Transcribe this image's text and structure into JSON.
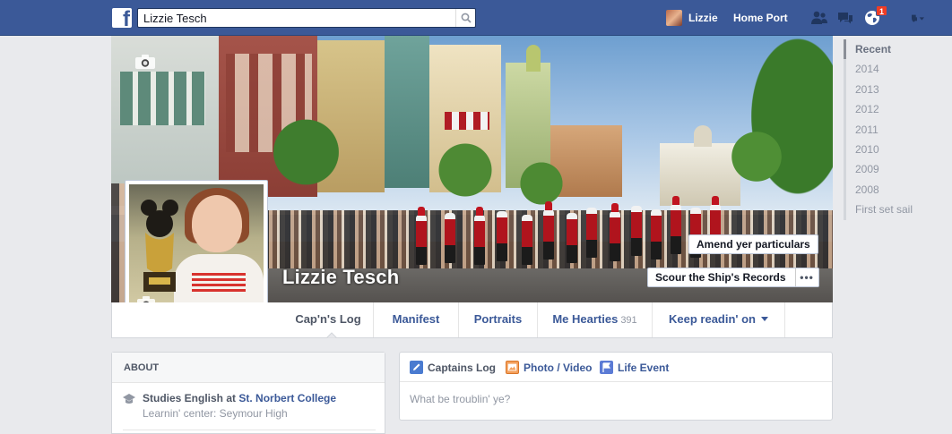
{
  "topbar": {
    "search_value": "Lizzie Tesch",
    "user_name": "Lizzie",
    "home_label": "Home Port",
    "notification_count": "1",
    "brand_color": "#3b5998"
  },
  "cover": {
    "profile_name": "Lizzie Tesch",
    "update_info_label": "Amend yer particulars",
    "activity_log_label": "Scour the Ship's Records",
    "more_label": "•••"
  },
  "tabs": [
    {
      "label": "Cap'n's Log",
      "count": ""
    },
    {
      "label": "Manifest",
      "count": ""
    },
    {
      "label": "Portraits",
      "count": ""
    },
    {
      "label": "Me Hearties",
      "count": "391"
    },
    {
      "label": "Keep readin' on",
      "count": ""
    }
  ],
  "timeline_nav": [
    "Recent",
    "2014",
    "2013",
    "2012",
    "2011",
    "2010",
    "2009",
    "2008",
    "First set sail"
  ],
  "about": {
    "header": "ABOUT",
    "study_prefix": "Studies English at",
    "study_school": "St. Norbert College",
    "school_line": "Learnin' center: Seymour High"
  },
  "composer": {
    "tabs": [
      "Captains Log",
      "Photo / Video",
      "Life Event"
    ],
    "placeholder": "What be troublin' ye?"
  }
}
